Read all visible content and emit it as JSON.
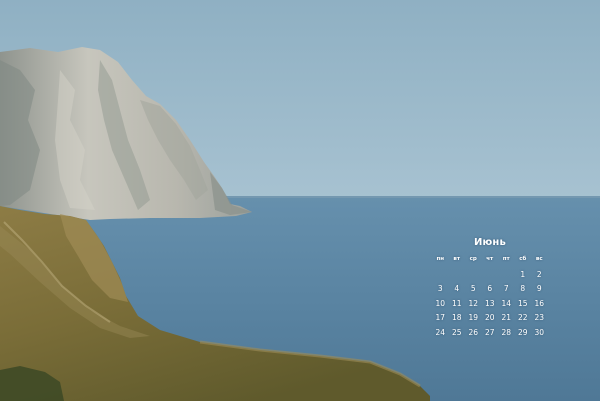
{
  "calendar": {
    "month": "Июнь",
    "weekdays": [
      "пн",
      "вт",
      "ср",
      "чт",
      "пт",
      "сб",
      "вс"
    ],
    "weeks": [
      [
        "",
        "",
        "",
        "",
        "",
        "1",
        "2"
      ],
      [
        "3",
        "4",
        "5",
        "6",
        "7",
        "8",
        "9"
      ],
      [
        "10",
        "11",
        "12",
        "13",
        "14",
        "15",
        "16"
      ],
      [
        "17",
        "18",
        "19",
        "20",
        "21",
        "22",
        "23"
      ],
      [
        "24",
        "25",
        "26",
        "27",
        "28",
        "29",
        "30"
      ]
    ]
  },
  "colors": {
    "sky": "#93b3c5",
    "sea": "#5c86a3",
    "cliff": "#bcbcb4",
    "hillside": "#7b6e3a",
    "calendar_text": "#ffffff"
  }
}
